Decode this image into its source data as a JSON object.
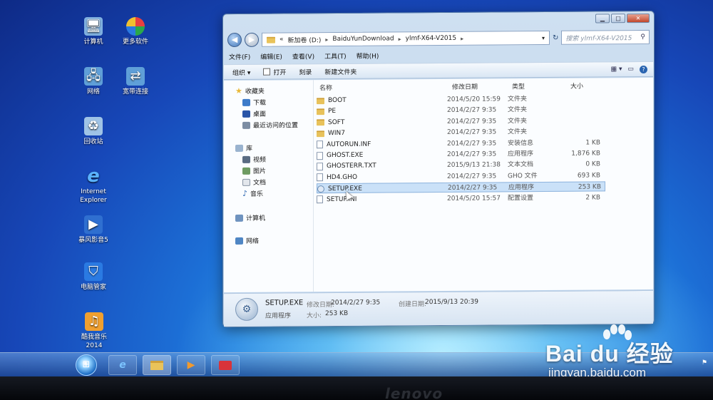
{
  "desktop": {
    "icons": [
      {
        "label": "计算机",
        "icon": "computer-icon",
        "color": "#7fb0e0"
      },
      {
        "label": "更多软件",
        "icon": "colorful-app-icon",
        "color": "#e04040"
      },
      {
        "label": "网络",
        "icon": "network-icon",
        "color": "#5f9fd8"
      },
      {
        "label": "宽带连接",
        "icon": "broadband-icon",
        "color": "#5f9fd8"
      },
      {
        "label": "回收站",
        "icon": "recycle-bin-icon",
        "color": "#9fc3e6"
      },
      {
        "label": "Internet Explorer",
        "icon": "ie-icon",
        "color": "#2a8be0"
      },
      {
        "label": "暴风影音5",
        "icon": "media-player-icon",
        "color": "#2f6fd0"
      },
      {
        "label": "电脑管家",
        "icon": "shield-icon",
        "color": "#2a7ae2"
      },
      {
        "label": "酷我音乐 2014",
        "icon": "music-icon",
        "color": "#f0a030"
      }
    ]
  },
  "window": {
    "address": {
      "prefix": "«",
      "crumbs": [
        "新加卷 (D:)",
        "BaiduYunDownload",
        "ylmf-X64-V2015"
      ]
    },
    "search": {
      "placeholder": "搜索 ylmf-X64-V2015"
    },
    "menu": [
      "文件(F)",
      "编辑(E)",
      "查看(V)",
      "工具(T)",
      "帮助(H)"
    ],
    "toolbar": {
      "organize": "组织 ▾",
      "open": "打开",
      "burn": "刻录",
      "new_folder": "新建文件夹"
    },
    "nav": {
      "favorites": "收藏夹",
      "downloads": "下载",
      "desktop": "桌面",
      "recent": "最近访问的位置",
      "libraries": "库",
      "videos": "视频",
      "pictures": "图片",
      "documents": "文档",
      "music": "音乐",
      "computer": "计算机",
      "network": "网络"
    },
    "columns": {
      "name": "名称",
      "date": "修改日期",
      "type": "类型",
      "size": "大小"
    },
    "files": [
      {
        "name": "BOOT",
        "date": "2014/5/20 15:59",
        "type": "文件夹",
        "size": "",
        "kind": "folder"
      },
      {
        "name": "PE",
        "date": "2014/2/27 9:35",
        "type": "文件夹",
        "size": "",
        "kind": "folder"
      },
      {
        "name": "SOFT",
        "date": "2014/2/27 9:35",
        "type": "文件夹",
        "size": "",
        "kind": "folder"
      },
      {
        "name": "WIN7",
        "date": "2014/2/27 9:35",
        "type": "文件夹",
        "size": "",
        "kind": "folder"
      },
      {
        "name": "AUTORUN.INF",
        "date": "2014/2/27 9:35",
        "type": "安装信息",
        "size": "1 KB",
        "kind": "file"
      },
      {
        "name": "GHOST.EXE",
        "date": "2014/2/27 9:35",
        "type": "应用程序",
        "size": "1,876 KB",
        "kind": "file"
      },
      {
        "name": "GHOSTERR.TXT",
        "date": "2015/9/13 21:38",
        "type": "文本文档",
        "size": "0 KB",
        "kind": "file"
      },
      {
        "name": "HD4.GHO",
        "date": "2014/2/27 9:35",
        "type": "GHO 文件",
        "size": "693 KB",
        "kind": "file"
      },
      {
        "name": "SETUP.EXE",
        "date": "2014/2/27 9:35",
        "type": "应用程序",
        "size": "253 KB",
        "kind": "exe",
        "selected": true
      },
      {
        "name": "SETUP.INI",
        "date": "2014/5/20 15:57",
        "type": "配置设置",
        "size": "2 KB",
        "kind": "file"
      }
    ],
    "details": {
      "filename": "SETUP.EXE",
      "modified_label": "修改日期:",
      "modified": "2014/2/27 9:35",
      "created_label": "创建日期:",
      "created": "2015/9/13 20:39",
      "type": "应用程序",
      "size_label": "大小:",
      "size": "253 KB"
    }
  },
  "watermark": {
    "brand": "Bai du 经验",
    "url": "jingyan.baidu.com"
  },
  "bezel": {
    "logo": "lenovo"
  }
}
